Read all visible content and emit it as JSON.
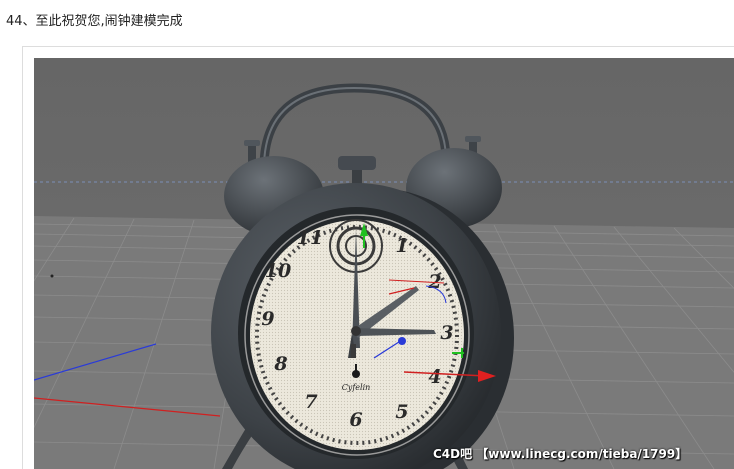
{
  "step": {
    "heading": "44、至此祝贺您,闹钟建模完成"
  },
  "viewport": {
    "scene": "alarm-clock-model",
    "dial": {
      "numerals": [
        "1",
        "2",
        "3",
        "4",
        "5",
        "6",
        "7",
        "8",
        "9",
        "10",
        "11"
      ],
      "brand": "Cyfelin"
    },
    "watermark": "C4D吧 【www.linecg.com/tieba/1799】",
    "colors": {
      "background": "#6b6b6b",
      "floor": "#7c7c7c",
      "clock_body": "#3d4247",
      "dial_face": "#e8e4d8",
      "axis_x": "#e02020",
      "axis_y": "#20c020",
      "axis_z": "#2a3bd8"
    }
  }
}
